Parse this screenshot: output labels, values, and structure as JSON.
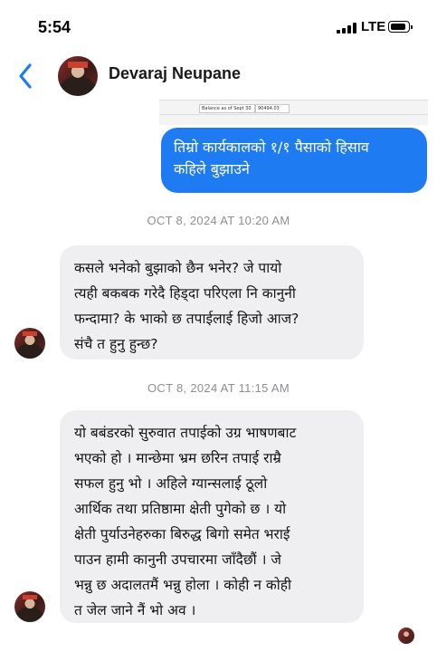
{
  "status_bar": {
    "time": "5:54",
    "network": "LTE"
  },
  "header": {
    "back_icon": "chevron-left-icon",
    "contact_name": "Devaraj Neupane",
    "accent_color": "#1e7bf2"
  },
  "attachment_preview": {
    "label": "Balance as of Sept 30",
    "value": "90494.03"
  },
  "messages": [
    {
      "direction": "outgoing",
      "lines": [
        "तिम्रो कार्यकालको १/१ पैसाको हिसाव",
        "कहिले बुझाउने"
      ]
    },
    {
      "direction": "incoming",
      "timestamp": "OCT 8, 2024 AT 10:20 AM",
      "lines": [
        "कसले भनेको बुझाको छैन भनेर? जे पायो",
        "त्यही बकबक गरेदै हिड्दा परिएला नि कानुनी",
        "फन्दामा? के भाको छ तपाईलाई हिजो आज?",
        "संचै त हुनु हुन्छ?"
      ]
    },
    {
      "direction": "incoming",
      "timestamp": "OCT 8, 2024 AT 11:15 AM",
      "lines": [
        "यो बबंडरको सुरुवात तपाईको उग्र भाषणबाट",
        "भएको हो । मान्छेमा भ्रम छरिन तपाई राम्रै",
        "सफल हुनु भो । अहिले ग्यान्सलाई ठूलो",
        "आर्थिक तथा प्रतिष्ठामा क्षेती पुगेको छ । यो",
        "क्षेती पुर्याउनेहरुका बिरुद्ध बिगो समेत भराई",
        "पाउन हामी कानुनी उपचारमा जाँदैछौं । जे",
        "भन्नु छ अदालतमैं भन्नु होला । कोही न कोही",
        "त जेल जाने नैं भो अव ।"
      ]
    }
  ]
}
